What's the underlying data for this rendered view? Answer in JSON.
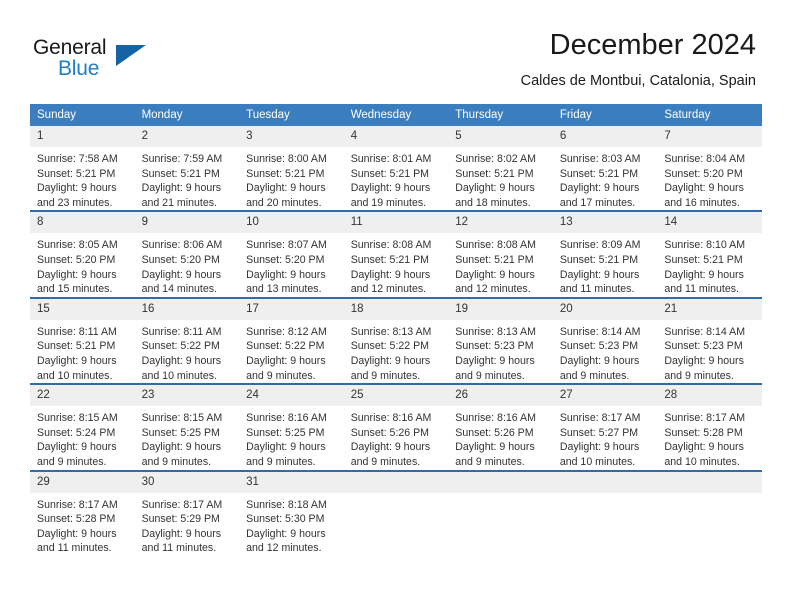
{
  "brand": {
    "name_top": "General",
    "name_bottom": "Blue",
    "triangle_color": "#1464a5",
    "blue_color": "#1f7ec4"
  },
  "header": {
    "title": "December 2024",
    "location": "Caldes de Montbui, Catalonia, Spain"
  },
  "theme": {
    "header_row_bg": "#3a7ebf",
    "row_border": "#2f6ca8",
    "daynum_bg": "#efefef",
    "text": "#333333"
  },
  "weekdays": [
    "Sunday",
    "Monday",
    "Tuesday",
    "Wednesday",
    "Thursday",
    "Friday",
    "Saturday"
  ],
  "weeks": [
    [
      {
        "day": "1",
        "sunrise": "Sunrise: 7:58 AM",
        "sunset": "Sunset: 5:21 PM",
        "daylight1": "Daylight: 9 hours",
        "daylight2": "and 23 minutes."
      },
      {
        "day": "2",
        "sunrise": "Sunrise: 7:59 AM",
        "sunset": "Sunset: 5:21 PM",
        "daylight1": "Daylight: 9 hours",
        "daylight2": "and 21 minutes."
      },
      {
        "day": "3",
        "sunrise": "Sunrise: 8:00 AM",
        "sunset": "Sunset: 5:21 PM",
        "daylight1": "Daylight: 9 hours",
        "daylight2": "and 20 minutes."
      },
      {
        "day": "4",
        "sunrise": "Sunrise: 8:01 AM",
        "sunset": "Sunset: 5:21 PM",
        "daylight1": "Daylight: 9 hours",
        "daylight2": "and 19 minutes."
      },
      {
        "day": "5",
        "sunrise": "Sunrise: 8:02 AM",
        "sunset": "Sunset: 5:21 PM",
        "daylight1": "Daylight: 9 hours",
        "daylight2": "and 18 minutes."
      },
      {
        "day": "6",
        "sunrise": "Sunrise: 8:03 AM",
        "sunset": "Sunset: 5:21 PM",
        "daylight1": "Daylight: 9 hours",
        "daylight2": "and 17 minutes."
      },
      {
        "day": "7",
        "sunrise": "Sunrise: 8:04 AM",
        "sunset": "Sunset: 5:20 PM",
        "daylight1": "Daylight: 9 hours",
        "daylight2": "and 16 minutes."
      }
    ],
    [
      {
        "day": "8",
        "sunrise": "Sunrise: 8:05 AM",
        "sunset": "Sunset: 5:20 PM",
        "daylight1": "Daylight: 9 hours",
        "daylight2": "and 15 minutes."
      },
      {
        "day": "9",
        "sunrise": "Sunrise: 8:06 AM",
        "sunset": "Sunset: 5:20 PM",
        "daylight1": "Daylight: 9 hours",
        "daylight2": "and 14 minutes."
      },
      {
        "day": "10",
        "sunrise": "Sunrise: 8:07 AM",
        "sunset": "Sunset: 5:20 PM",
        "daylight1": "Daylight: 9 hours",
        "daylight2": "and 13 minutes."
      },
      {
        "day": "11",
        "sunrise": "Sunrise: 8:08 AM",
        "sunset": "Sunset: 5:21 PM",
        "daylight1": "Daylight: 9 hours",
        "daylight2": "and 12 minutes."
      },
      {
        "day": "12",
        "sunrise": "Sunrise: 8:08 AM",
        "sunset": "Sunset: 5:21 PM",
        "daylight1": "Daylight: 9 hours",
        "daylight2": "and 12 minutes."
      },
      {
        "day": "13",
        "sunrise": "Sunrise: 8:09 AM",
        "sunset": "Sunset: 5:21 PM",
        "daylight1": "Daylight: 9 hours",
        "daylight2": "and 11 minutes."
      },
      {
        "day": "14",
        "sunrise": "Sunrise: 8:10 AM",
        "sunset": "Sunset: 5:21 PM",
        "daylight1": "Daylight: 9 hours",
        "daylight2": "and 11 minutes."
      }
    ],
    [
      {
        "day": "15",
        "sunrise": "Sunrise: 8:11 AM",
        "sunset": "Sunset: 5:21 PM",
        "daylight1": "Daylight: 9 hours",
        "daylight2": "and 10 minutes."
      },
      {
        "day": "16",
        "sunrise": "Sunrise: 8:11 AM",
        "sunset": "Sunset: 5:22 PM",
        "daylight1": "Daylight: 9 hours",
        "daylight2": "and 10 minutes."
      },
      {
        "day": "17",
        "sunrise": "Sunrise: 8:12 AM",
        "sunset": "Sunset: 5:22 PM",
        "daylight1": "Daylight: 9 hours",
        "daylight2": "and 9 minutes."
      },
      {
        "day": "18",
        "sunrise": "Sunrise: 8:13 AM",
        "sunset": "Sunset: 5:22 PM",
        "daylight1": "Daylight: 9 hours",
        "daylight2": "and 9 minutes."
      },
      {
        "day": "19",
        "sunrise": "Sunrise: 8:13 AM",
        "sunset": "Sunset: 5:23 PM",
        "daylight1": "Daylight: 9 hours",
        "daylight2": "and 9 minutes."
      },
      {
        "day": "20",
        "sunrise": "Sunrise: 8:14 AM",
        "sunset": "Sunset: 5:23 PM",
        "daylight1": "Daylight: 9 hours",
        "daylight2": "and 9 minutes."
      },
      {
        "day": "21",
        "sunrise": "Sunrise: 8:14 AM",
        "sunset": "Sunset: 5:23 PM",
        "daylight1": "Daylight: 9 hours",
        "daylight2": "and 9 minutes."
      }
    ],
    [
      {
        "day": "22",
        "sunrise": "Sunrise: 8:15 AM",
        "sunset": "Sunset: 5:24 PM",
        "daylight1": "Daylight: 9 hours",
        "daylight2": "and 9 minutes."
      },
      {
        "day": "23",
        "sunrise": "Sunrise: 8:15 AM",
        "sunset": "Sunset: 5:25 PM",
        "daylight1": "Daylight: 9 hours",
        "daylight2": "and 9 minutes."
      },
      {
        "day": "24",
        "sunrise": "Sunrise: 8:16 AM",
        "sunset": "Sunset: 5:25 PM",
        "daylight1": "Daylight: 9 hours",
        "daylight2": "and 9 minutes."
      },
      {
        "day": "25",
        "sunrise": "Sunrise: 8:16 AM",
        "sunset": "Sunset: 5:26 PM",
        "daylight1": "Daylight: 9 hours",
        "daylight2": "and 9 minutes."
      },
      {
        "day": "26",
        "sunrise": "Sunrise: 8:16 AM",
        "sunset": "Sunset: 5:26 PM",
        "daylight1": "Daylight: 9 hours",
        "daylight2": "and 9 minutes."
      },
      {
        "day": "27",
        "sunrise": "Sunrise: 8:17 AM",
        "sunset": "Sunset: 5:27 PM",
        "daylight1": "Daylight: 9 hours",
        "daylight2": "and 10 minutes."
      },
      {
        "day": "28",
        "sunrise": "Sunrise: 8:17 AM",
        "sunset": "Sunset: 5:28 PM",
        "daylight1": "Daylight: 9 hours",
        "daylight2": "and 10 minutes."
      }
    ],
    [
      {
        "day": "29",
        "sunrise": "Sunrise: 8:17 AM",
        "sunset": "Sunset: 5:28 PM",
        "daylight1": "Daylight: 9 hours",
        "daylight2": "and 11 minutes."
      },
      {
        "day": "30",
        "sunrise": "Sunrise: 8:17 AM",
        "sunset": "Sunset: 5:29 PM",
        "daylight1": "Daylight: 9 hours",
        "daylight2": "and 11 minutes."
      },
      {
        "day": "31",
        "sunrise": "Sunrise: 8:18 AM",
        "sunset": "Sunset: 5:30 PM",
        "daylight1": "Daylight: 9 hours",
        "daylight2": "and 12 minutes."
      },
      {
        "day": "",
        "sunrise": "",
        "sunset": "",
        "daylight1": "",
        "daylight2": ""
      },
      {
        "day": "",
        "sunrise": "",
        "sunset": "",
        "daylight1": "",
        "daylight2": ""
      },
      {
        "day": "",
        "sunrise": "",
        "sunset": "",
        "daylight1": "",
        "daylight2": ""
      },
      {
        "day": "",
        "sunrise": "",
        "sunset": "",
        "daylight1": "",
        "daylight2": ""
      }
    ]
  ]
}
